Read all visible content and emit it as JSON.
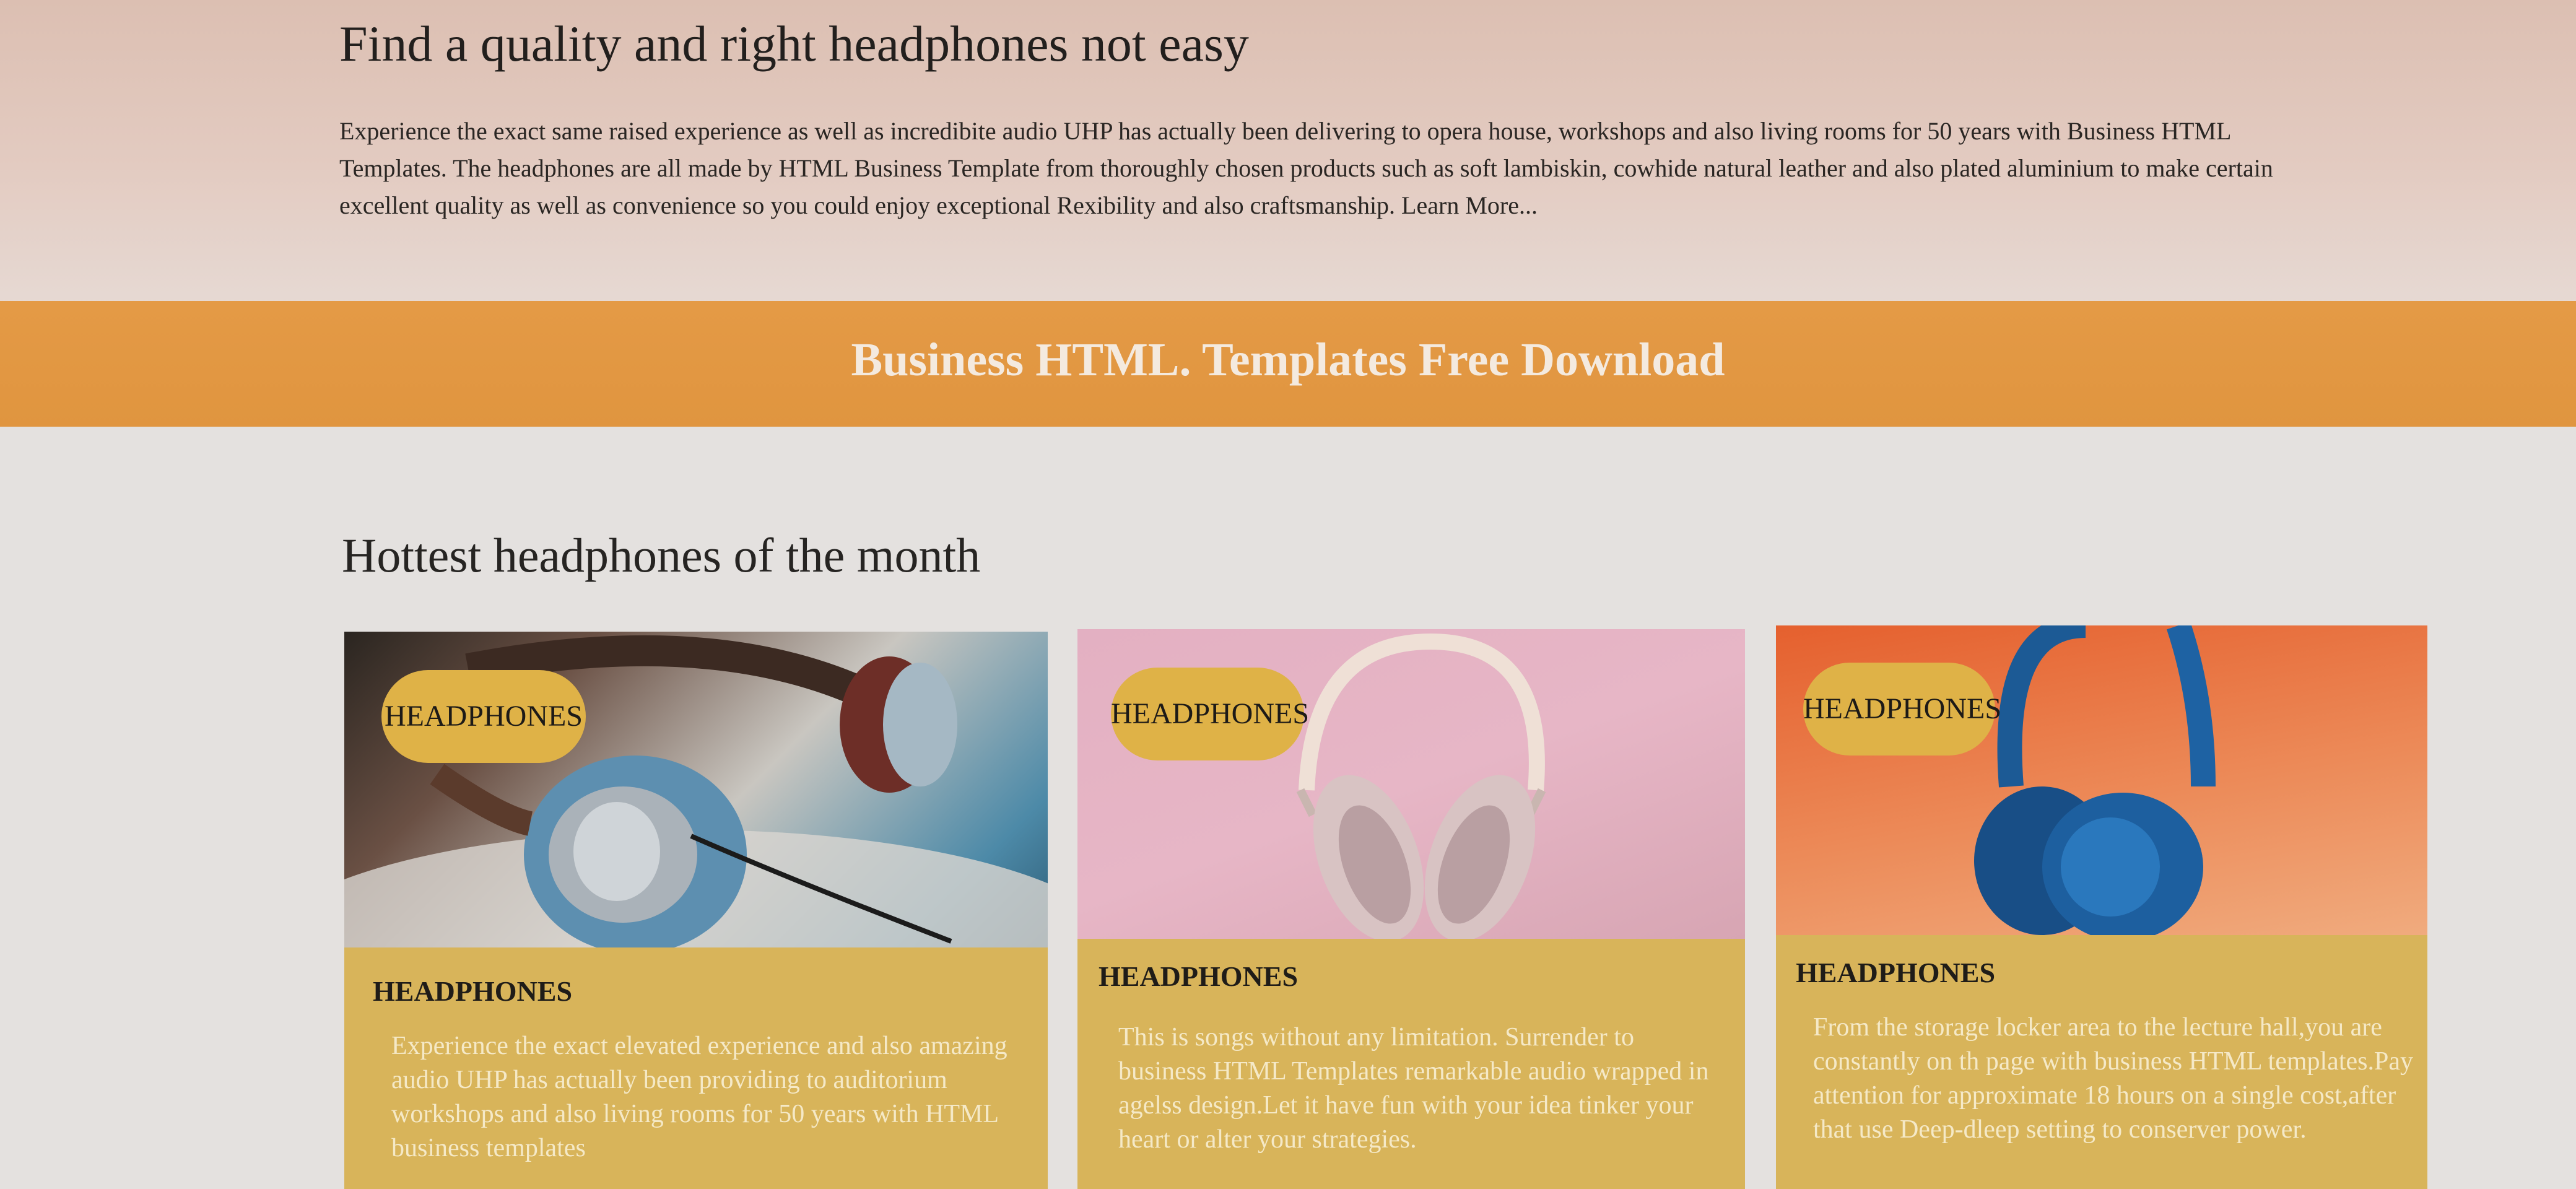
{
  "intro": {
    "title": "Find a quality and right headphones not easy",
    "text": "Experience the exact same raised experience as well as incredibite audio UHP has actually been delivering to opera house, workshops and also living rooms for 50 years with Business HTML Templates. The headphones are all made by HTML Business Template from thoroughly chosen products such as soft lambiskin, cowhide natural leather and also plated aluminium to make certain excellent quality as well as convenience so you could enjoy exceptional Rexibility and also craftsmanship. Learn More..."
  },
  "banner": {
    "text": "Business HTML. Templates Free Download",
    "color": "#e49a46"
  },
  "section": {
    "title": "Hottest headphones of the month"
  },
  "cards": [
    {
      "badge": "HEADPHONES",
      "title": "HEADPHONES",
      "text": "Experience the exact elevated experience and also amazing audio UHP has actually been providing to auditorium workshops and also living rooms for 50 years with HTML business templates",
      "image_icon": "headphones-image-icon"
    },
    {
      "badge": "HEADPHONES",
      "title": "HEADPHONES",
      "text": "This is songs without any limitation. Surrender to business HTML Templates remarkable audio wrapped in agelss design.Let it have fun with your idea tinker your heart or alter your strategies.",
      "image_icon": "headphones-image-icon"
    },
    {
      "badge": "HEADPHONES",
      "title": "HEADPHONES",
      "text": "From the storage locker area to the lecture hall,you are constantly on th page with business HTML templates.Pay attention for approximate 18 hours on a single cost,after that use Deep-dleep setting to conserver power.",
      "image_icon": "headphones-image-icon"
    }
  ],
  "colors": {
    "card_background": "#d8b45a",
    "badge": "#dfb247",
    "card_text": "#f5e9c7"
  }
}
